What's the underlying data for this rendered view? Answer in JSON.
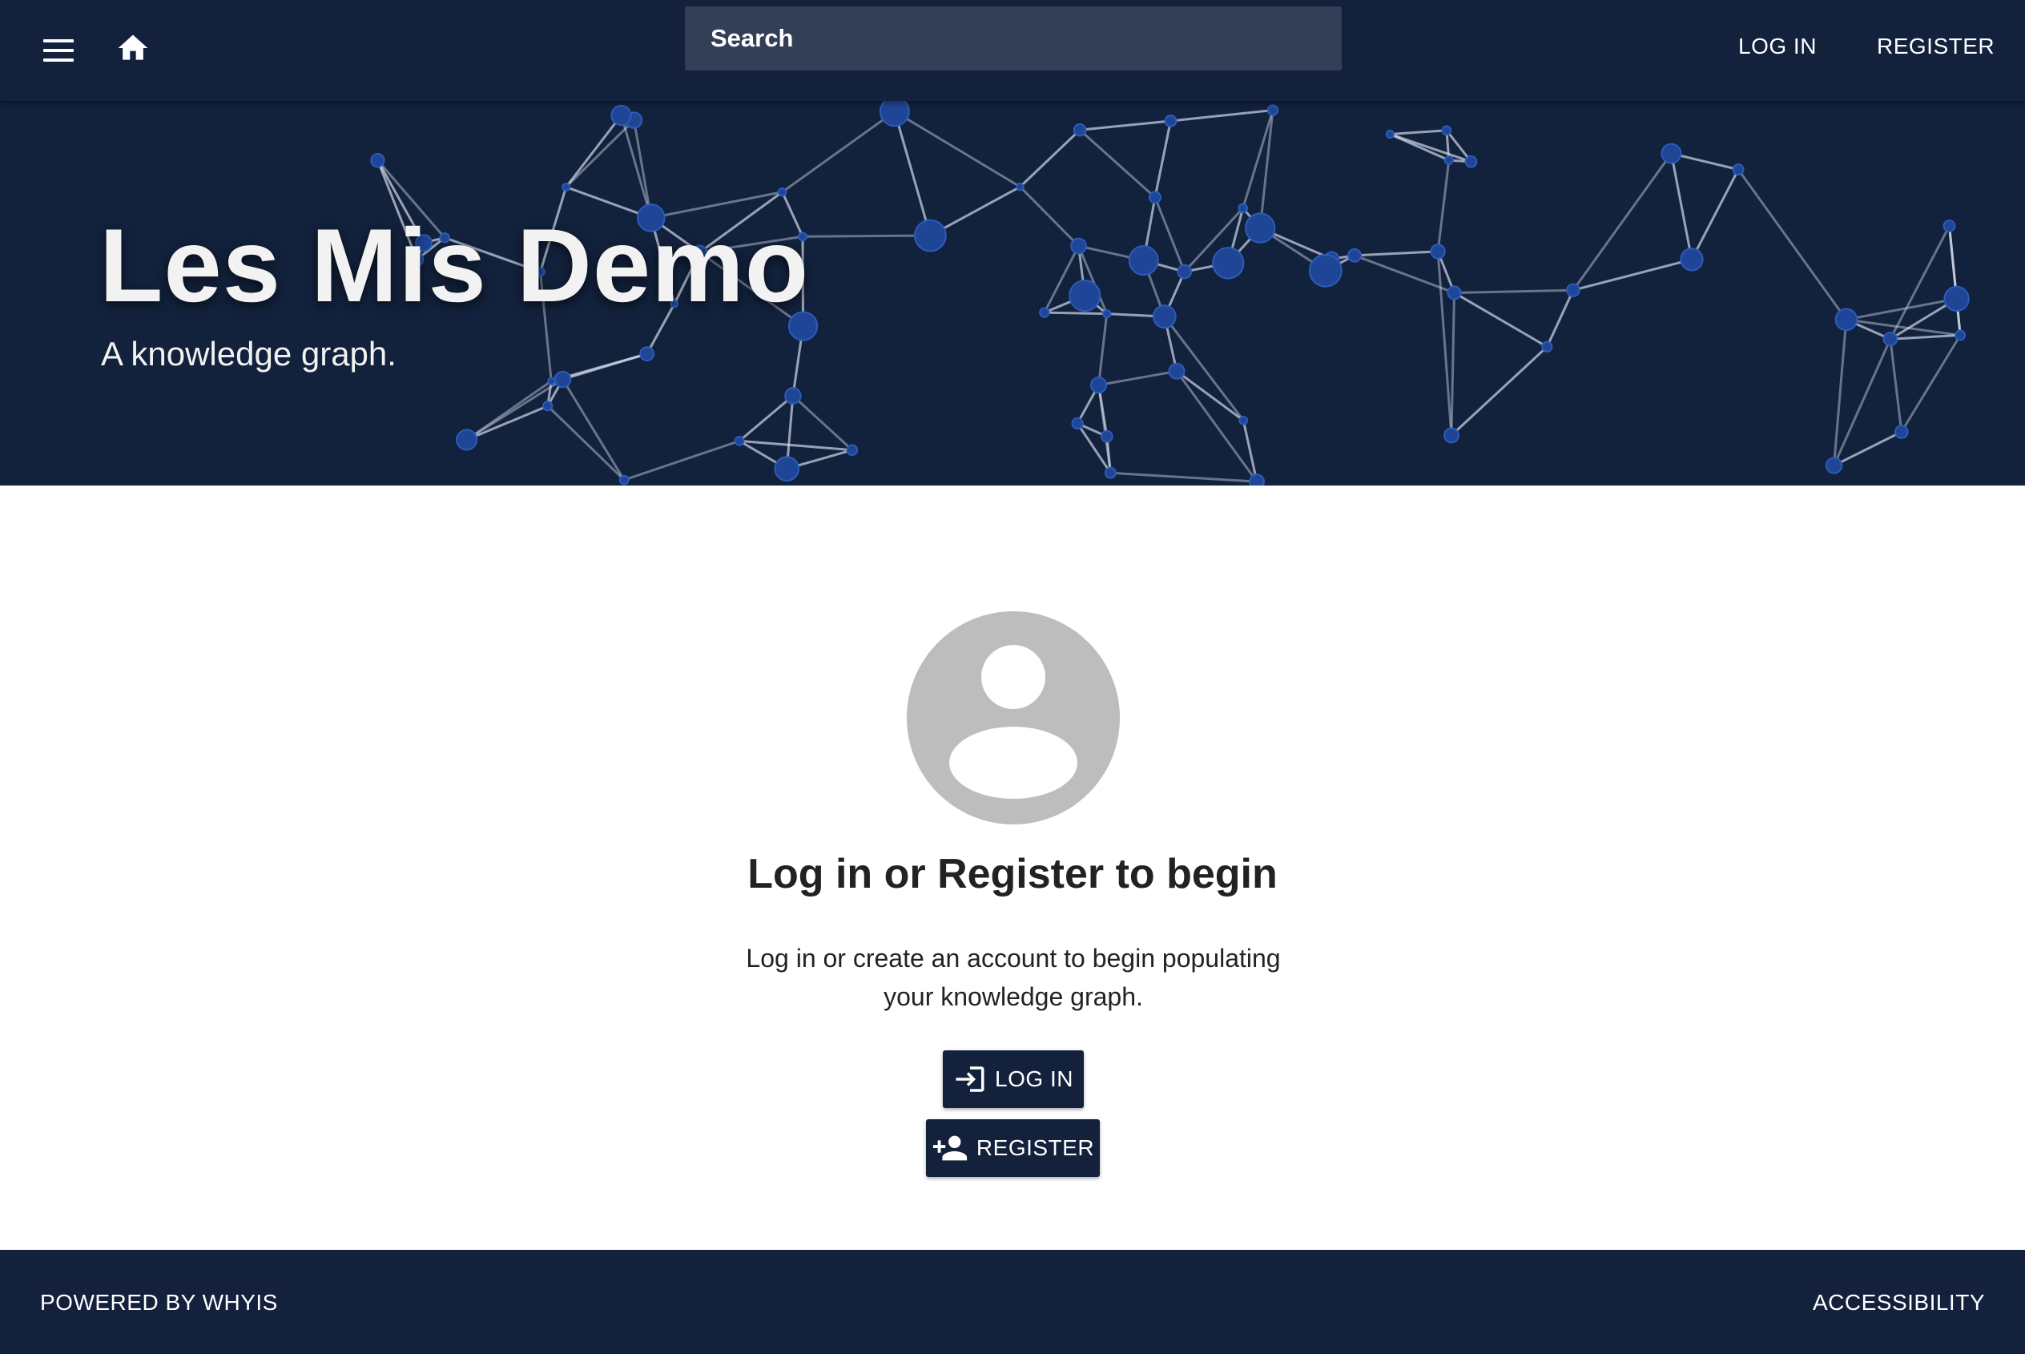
{
  "header": {
    "search_placeholder": "Search",
    "login_label": "LOG IN",
    "register_label": "REGISTER",
    "menu_icon": "hamburger-menu-icon",
    "home_icon": "home-icon"
  },
  "hero": {
    "title": "Les Mis Demo",
    "subtitle": "A knowledge graph."
  },
  "main": {
    "avatar_icon": "account-circle-icon",
    "heading": "Log in or Register to begin",
    "description": "Log in or create an account to begin populating your knowledge graph.",
    "login_button": "LOG IN",
    "login_icon": "login-icon",
    "register_button": "REGISTER",
    "register_icon": "person-add-icon"
  },
  "footer": {
    "powered_by": "POWERED BY WHYIS",
    "accessibility": "ACCESSIBILITY"
  },
  "colors": {
    "navy": "#13213d",
    "search_bg": "#333f56",
    "avatar_gray": "#bdbdbd",
    "node_blue": "#1f4596"
  }
}
